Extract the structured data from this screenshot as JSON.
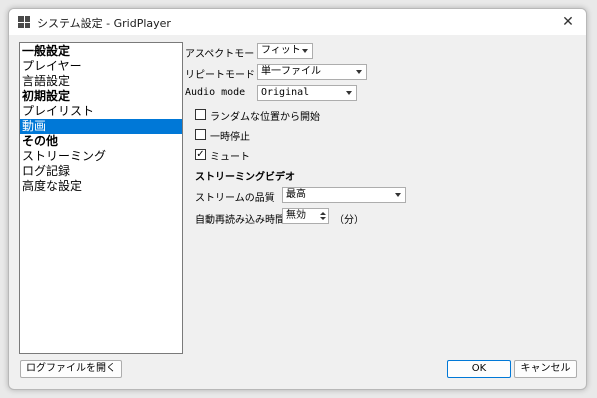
{
  "window": {
    "title": "システム設定 - GridPlayer",
    "close_symbol": "✕"
  },
  "sidebar": {
    "items": [
      {
        "label": "一般設定",
        "bold": true,
        "selected": false
      },
      {
        "label": "プレイヤー",
        "bold": false,
        "selected": false
      },
      {
        "label": "言語設定",
        "bold": false,
        "selected": false
      },
      {
        "label": "初期設定",
        "bold": true,
        "selected": false
      },
      {
        "label": "プレイリスト",
        "bold": false,
        "selected": false
      },
      {
        "label": "動画",
        "bold": false,
        "selected": true
      },
      {
        "label": "その他",
        "bold": true,
        "selected": false
      },
      {
        "label": "ストリーミング",
        "bold": false,
        "selected": false
      },
      {
        "label": "ログ記録",
        "bold": false,
        "selected": false
      },
      {
        "label": "高度な設定",
        "bold": false,
        "selected": false
      }
    ]
  },
  "settings": {
    "aspect_mode": {
      "label": "アスペクトモード",
      "value": "フィット"
    },
    "repeat_mode": {
      "label": "リピートモード",
      "value": "単一ファイル"
    },
    "audio_mode": {
      "label": "Audio mode",
      "value": "Original"
    },
    "random_position": {
      "label": "ランダムな位置から開始",
      "checked": false
    },
    "pause": {
      "label": "一時停止",
      "checked": false
    },
    "mute": {
      "label": "ミュート",
      "checked": true,
      "check_symbol": "✓"
    },
    "streaming_section": "ストリーミングビデオ",
    "stream_quality": {
      "label": "ストリームの品質",
      "value": "最高"
    },
    "auto_reload": {
      "label": "自動再読み込み時間",
      "value": "無効",
      "unit": "（分）"
    }
  },
  "buttons": {
    "open_log": "ログファイルを開く",
    "ok": "OK",
    "cancel": "キャンセル"
  }
}
